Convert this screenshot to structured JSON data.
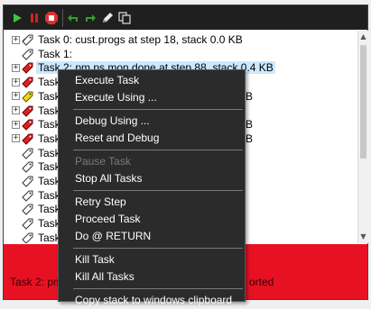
{
  "toolbar": {
    "buttons": [
      {
        "icon": "run-icon",
        "color": "#3cc83c"
      },
      {
        "icon": "pause-icon",
        "color": "#d42020"
      },
      {
        "icon": "stop-icon",
        "color": "#e03030"
      },
      {
        "icon": "step-back-icon",
        "color": "#30a030"
      },
      {
        "icon": "step-over-icon",
        "color": "#30a030"
      },
      {
        "icon": "edit-icon",
        "color": "#e0e0e0"
      },
      {
        "icon": "copy-icon",
        "color": "#e0e0e0"
      }
    ]
  },
  "tasks": [
    {
      "label": "Task 0: cust.progs at step 18, stack 0.0 KB",
      "expander": "+",
      "icon": "gray"
    },
    {
      "label": "Task 1:",
      "expander": "",
      "icon": "outline"
    },
    {
      "label": "Task 2: pm.ps.mon done at step 88, stack 0.4 KB",
      "expander": "+",
      "icon": "red",
      "selected": true
    },
    {
      "label": "Task",
      "expander": "+",
      "icon": "red"
    },
    {
      "label": "Task",
      "expander": "+",
      "icon": "yellow",
      "tail": "B"
    },
    {
      "label": "Task",
      "expander": "+",
      "icon": "red"
    },
    {
      "label": "Task",
      "expander": "+",
      "icon": "red",
      "tail": "B"
    },
    {
      "label": "Task",
      "expander": "+",
      "icon": "red",
      "tail": "B"
    },
    {
      "label": "Task",
      "expander": "",
      "icon": "outline"
    },
    {
      "label": "Task",
      "expander": "",
      "icon": "outline"
    },
    {
      "label": "Task",
      "expander": "",
      "icon": "outline"
    },
    {
      "label": "Task",
      "expander": "",
      "icon": "outline"
    },
    {
      "label": "Task",
      "expander": "",
      "icon": "outline"
    },
    {
      "label": "Task",
      "expander": "",
      "icon": "outline"
    },
    {
      "label": "Task",
      "expander": "",
      "icon": "outline"
    }
  ],
  "status": {
    "left_text": "Task 2: pm",
    "right_text": "orted",
    "color": "#e81123"
  },
  "context_menu": {
    "items": [
      {
        "label": "Execute Task",
        "enabled": true
      },
      {
        "label": "Execute Using ...",
        "enabled": true
      },
      {
        "separator": true
      },
      {
        "label": "Debug Using ...",
        "enabled": true
      },
      {
        "label": "Reset and Debug",
        "enabled": true
      },
      {
        "separator": true
      },
      {
        "label": "Pause Task",
        "enabled": false
      },
      {
        "label": "Stop All Tasks",
        "enabled": true
      },
      {
        "separator": true
      },
      {
        "label": "Retry Step",
        "enabled": true
      },
      {
        "label": "Proceed Task",
        "enabled": true
      },
      {
        "label": "Do @ RETURN",
        "enabled": true
      },
      {
        "separator": true
      },
      {
        "label": "Kill Task",
        "enabled": true
      },
      {
        "label": "Kill All Tasks",
        "enabled": true
      },
      {
        "separator": true
      },
      {
        "label": "Copy stack to windows clipboard",
        "enabled": true
      }
    ]
  }
}
